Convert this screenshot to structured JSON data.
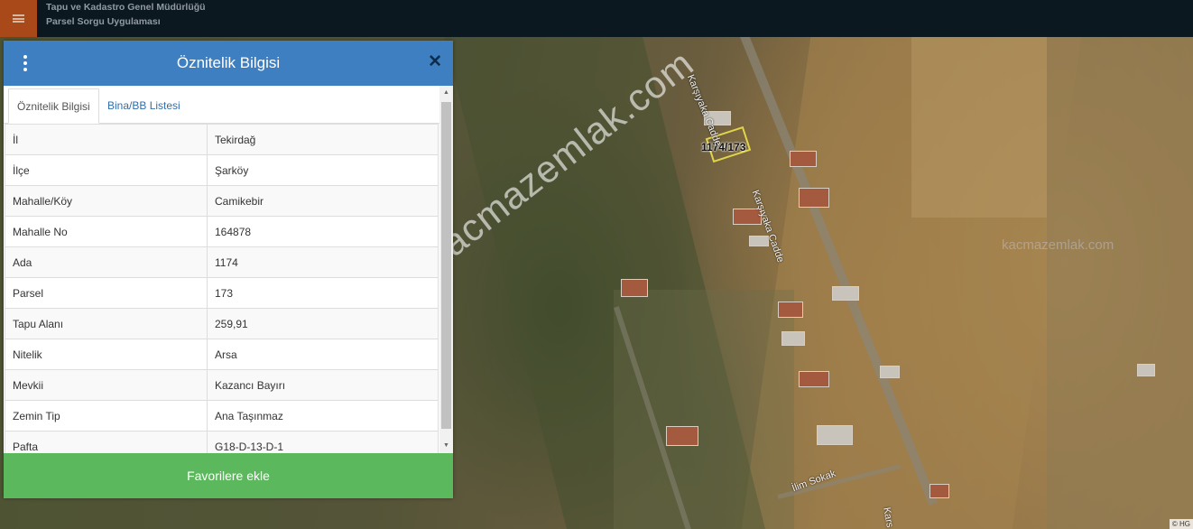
{
  "app": {
    "title_line1": "Tapu ve Kadastro Genel Müdürlüğü",
    "title_line2": "Parsel Sorgu Uygulaması"
  },
  "map": {
    "parcel_label": "1174/173",
    "streets": [
      "Karşıyaka Cadde",
      "Karşıyaka Cadde",
      "İlim Sokak",
      "Kars"
    ],
    "watermark": "kacmazemlak.com",
    "watermark2": "kacmazemlak.com",
    "copyright": "© HG"
  },
  "panel": {
    "title": "Öznitelik Bilgisi",
    "close_symbol": "✕",
    "tabs": [
      {
        "label": "Öznitelik Bilgisi",
        "active": true
      },
      {
        "label": "Bina/BB Listesi",
        "active": false
      }
    ],
    "rows": [
      {
        "key": "İl",
        "value": "Tekirdağ"
      },
      {
        "key": "İlçe",
        "value": "Şarköy"
      },
      {
        "key": "Mahalle/Köy",
        "value": "Camikebir"
      },
      {
        "key": "Mahalle No",
        "value": "164878"
      },
      {
        "key": "Ada",
        "value": "1174"
      },
      {
        "key": "Parsel",
        "value": "173"
      },
      {
        "key": "Tapu Alanı",
        "value": "259,91"
      },
      {
        "key": "Nitelik",
        "value": "Arsa"
      },
      {
        "key": "Mevkii",
        "value": "Kazancı Bayırı"
      },
      {
        "key": "Zemin Tip",
        "value": "Ana Taşınmaz"
      },
      {
        "key": "Pafta",
        "value": "G18-D-13-D-1"
      }
    ],
    "favorite_button": "Favorilere ekle"
  },
  "colors": {
    "header_blue": "#3d7fc1",
    "menu_orange": "#a9491a",
    "favorite_green": "#5cb85c",
    "topbar": "#0c1820"
  },
  "icons": {
    "menu": "hamburger-menu-icon",
    "kebab": "vertical-dots-icon",
    "close": "close-icon"
  }
}
